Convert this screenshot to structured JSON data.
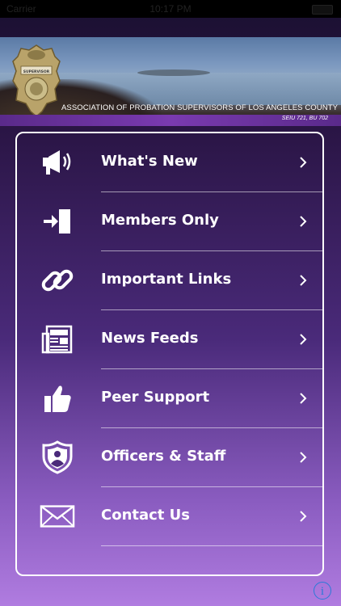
{
  "status_bar": {
    "carrier": "Carrier",
    "time": "10:17 PM"
  },
  "header": {
    "organization": "ASSOCIATION OF PROBATION SUPERVISORS OF LOS ANGELES COUNTY",
    "union": "SEIU 721, BU 702",
    "badge_text": "SUPERVISOR"
  },
  "menu": {
    "items": [
      {
        "label": "What's New",
        "icon": "megaphone-icon"
      },
      {
        "label": "Members Only",
        "icon": "login-door-icon"
      },
      {
        "label": "Important Links",
        "icon": "chain-link-icon"
      },
      {
        "label": "News Feeds",
        "icon": "newspaper-icon"
      },
      {
        "label": "Peer Support",
        "icon": "thumbs-up-icon"
      },
      {
        "label": "Officers & Staff",
        "icon": "shield-person-icon"
      },
      {
        "label": "Contact Us",
        "icon": "envelope-icon"
      }
    ]
  },
  "info_button": {
    "glyph": "i"
  },
  "colors": {
    "accent_blue": "#2a7ad8",
    "text": "#ffffff"
  }
}
